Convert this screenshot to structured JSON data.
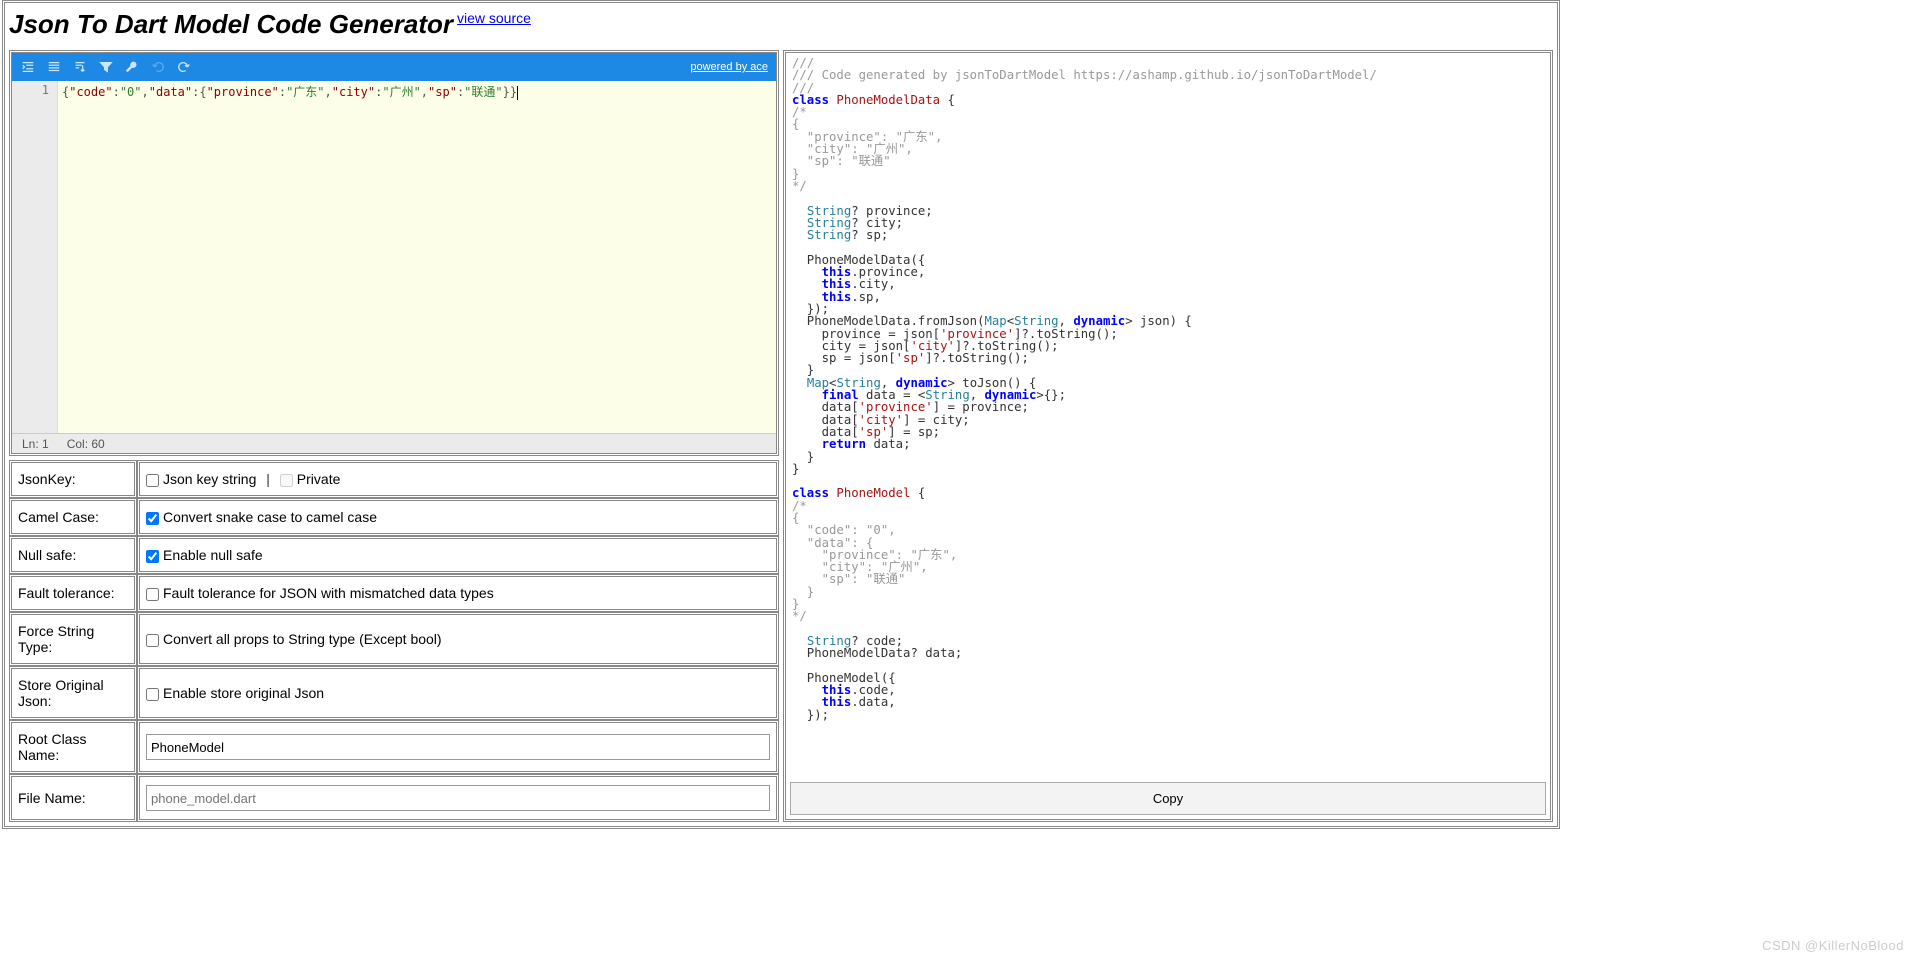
{
  "header": {
    "title": "Json To Dart Model Code Generator",
    "view_source": "view source"
  },
  "toolbar": {
    "powered": "powered by ace"
  },
  "editor": {
    "line_number": "1",
    "json_line": "{\"code\":\"0\",\"data\":{\"province\":\"广东\",\"city\":\"广州\",\"sp\":\"联通\"}}",
    "ln_label": "Ln: 1",
    "col_label": "Col: 60"
  },
  "options": {
    "jsonkey_label": "JsonKey:",
    "jsonkey_text": "Json key string",
    "private_label": "Private",
    "camel_label": "Camel Case:",
    "camel_text": "Convert snake case to camel case",
    "nullsafe_label": "Null safe:",
    "nullsafe_text": "Enable null safe",
    "fault_label": "Fault tolerance:",
    "fault_text": "Fault tolerance for JSON with mismatched data types",
    "force_label": "Force String Type:",
    "force_text": "Convert all props to String type (Except bool)",
    "store_label": "Store Original Json:",
    "store_text": "Enable store original Json",
    "root_label": "Root Class Name:",
    "root_value": "PhoneModel",
    "file_label": "File Name:",
    "file_placeholder": "phone_model.dart"
  },
  "copy_label": "Copy",
  "watermark": "CSDN @KillerNoBlood",
  "dart_code": {
    "c1": "///",
    "c2": "/// Code generated by jsonToDartModel https://ashamp.github.io/jsonToDartModel/",
    "c3": "///",
    "class1": "class ",
    "classname1": "PhoneModelData",
    "ob": " {",
    "cm_o": "/*",
    "cm_b1": "{",
    "cm_prov": "  \"province\": \"广东\",",
    "cm_city": "  \"city\": \"广州\",",
    "cm_sp": "  \"sp\": \"联通\"",
    "cm_b2": "}",
    "cm_c": "*/",
    "str": "String",
    "q_prov": "? province;",
    "q_city": "? city;",
    "q_sp": "? sp;",
    "ctor1": "  PhoneModelData({",
    "this": "this",
    "p_prov": ".province,",
    "p_city": ".city,",
    "p_sp": ".sp,",
    "ctor_end": "  });",
    "fromjson1": "  PhoneModelData.fromJson(",
    "map": "Map",
    "lt": "<",
    "comma_sp": ", ",
    "dynamic": "dynamic",
    "gt_json": "> json) {",
    "fj_prov_a": "    province = json[",
    "s_prov": "'province'",
    "fj_b": "]?.toString();",
    "fj_city_a": "    city = json[",
    "s_city": "'city'",
    "fj_sp_a": "    sp = json[",
    "s_sp": "'sp'",
    "close_b": "  }",
    "tojson_a": "  ",
    "gt_tojson": "> toJson() {",
    "final": "final",
    "data_eq": " data = <",
    "gt_empty": ">{};",
    "tj_prov_a": "    data[",
    "tj_prov_b": "] = province;",
    "tj_city_b": "] = city;",
    "tj_sp_b": "] = sp;",
    "return": "return",
    "return_d": " data;",
    "close_all": "}",
    "classname2": "PhoneModel",
    "cm2_code": "  \"code\": \"0\",",
    "cm2_data": "  \"data\": {",
    "cm2_prov": "    \"province\": \"广东\",",
    "cm2_city": "    \"city\": \"广州\",",
    "cm2_sp": "    \"sp\": \"联通\"",
    "cm2_cb": "  }",
    "q_code": "? code;",
    "pmd_data": "  PhoneModelData? data;",
    "ctor2": "  PhoneModel({",
    "p_code": ".code,",
    "p_data": ".data,"
  }
}
